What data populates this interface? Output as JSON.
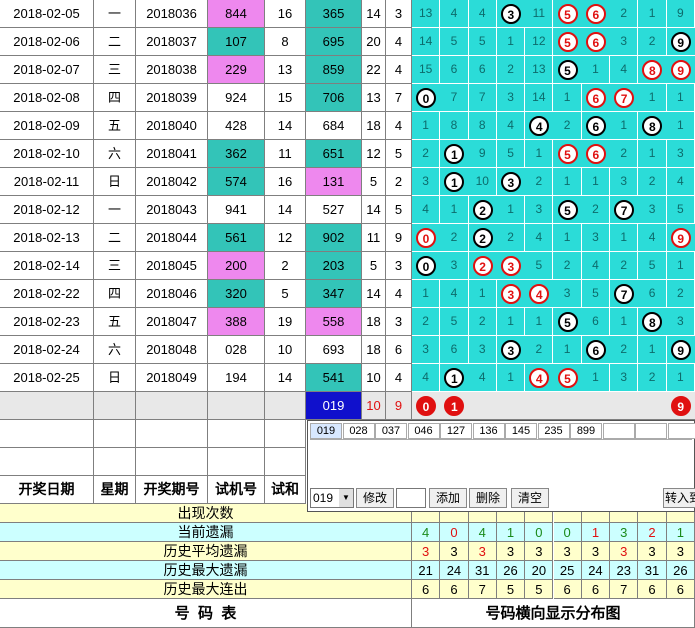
{
  "rows": [
    {
      "date": "2018-02-05",
      "weekday": "一",
      "issue": "2018036",
      "test": "844",
      "sum": "16",
      "draw": "365",
      "draw_sum": "14",
      "span": "3",
      "test_color": "pink",
      "draw_color": "teal",
      "cells": [
        "13",
        "4",
        "4",
        "3",
        "11",
        "5",
        "6",
        "2",
        "1",
        "9"
      ],
      "balls": [
        {
          "i": 3,
          "n": "3",
          "c": "black"
        },
        {
          "i": 5,
          "n": "5",
          "c": "red"
        },
        {
          "i": 6,
          "n": "6",
          "c": "red"
        }
      ]
    },
    {
      "date": "2018-02-06",
      "weekday": "二",
      "issue": "2018037",
      "test": "107",
      "sum": "8",
      "draw": "695",
      "draw_sum": "20",
      "span": "4",
      "test_color": "teal",
      "draw_color": "teal",
      "cells": [
        "14",
        "5",
        "5",
        "1",
        "12",
        "5",
        "6",
        "3",
        "2",
        "9"
      ],
      "balls": [
        {
          "i": 5,
          "n": "5",
          "c": "red"
        },
        {
          "i": 6,
          "n": "6",
          "c": "red"
        },
        {
          "i": 9,
          "n": "9",
          "c": "black"
        }
      ]
    },
    {
      "date": "2018-02-07",
      "weekday": "三",
      "issue": "2018038",
      "test": "229",
      "sum": "13",
      "draw": "859",
      "draw_sum": "22",
      "span": "4",
      "test_color": "pink",
      "draw_color": "teal",
      "cells": [
        "15",
        "6",
        "6",
        "2",
        "13",
        "5",
        "1",
        "4",
        "8",
        "9"
      ],
      "balls": [
        {
          "i": 5,
          "n": "5",
          "c": "black"
        },
        {
          "i": 8,
          "n": "8",
          "c": "red"
        },
        {
          "i": 9,
          "n": "9",
          "c": "red"
        }
      ]
    },
    {
      "date": "2018-02-08",
      "weekday": "四",
      "issue": "2018039",
      "test": "924",
      "sum": "15",
      "draw": "706",
      "draw_sum": "13",
      "span": "7",
      "test_color": "",
      "draw_color": "teal",
      "cells": [
        "0",
        "7",
        "7",
        "3",
        "14",
        "1",
        "6",
        "7",
        "1",
        "1"
      ],
      "balls": [
        {
          "i": 0,
          "n": "0",
          "c": "black"
        },
        {
          "i": 6,
          "n": "6",
          "c": "red"
        },
        {
          "i": 7,
          "n": "7",
          "c": "red"
        }
      ]
    },
    {
      "date": "2018-02-09",
      "weekday": "五",
      "issue": "2018040",
      "test": "428",
      "sum": "14",
      "draw": "684",
      "draw_sum": "18",
      "span": "4",
      "test_color": "",
      "draw_color": "",
      "cells": [
        "1",
        "8",
        "8",
        "4",
        "4",
        "2",
        "6",
        "1",
        "8",
        "1"
      ],
      "balls": [
        {
          "i": 4,
          "n": "4",
          "c": "black"
        },
        {
          "i": 6,
          "n": "6",
          "c": "black"
        },
        {
          "i": 8,
          "n": "8",
          "c": "black"
        }
      ]
    },
    {
      "date": "2018-02-10",
      "weekday": "六",
      "issue": "2018041",
      "test": "362",
      "sum": "11",
      "draw": "651",
      "draw_sum": "12",
      "span": "5",
      "test_color": "teal",
      "draw_color": "teal",
      "cells": [
        "2",
        "1",
        "9",
        "5",
        "1",
        "5",
        "6",
        "2",
        "1",
        "3"
      ],
      "balls": [
        {
          "i": 1,
          "n": "1",
          "c": "black"
        },
        {
          "i": 5,
          "n": "5",
          "c": "red"
        },
        {
          "i": 6,
          "n": "6",
          "c": "red"
        }
      ]
    },
    {
      "date": "2018-02-11",
      "weekday": "日",
      "issue": "2018042",
      "test": "574",
      "sum": "16",
      "draw": "131",
      "draw_sum": "5",
      "span": "2",
      "test_color": "teal",
      "draw_color": "pink",
      "cells": [
        "3",
        "1",
        "10",
        "3",
        "2",
        "1",
        "1",
        "3",
        "2",
        "4"
      ],
      "balls": [
        {
          "i": 1,
          "n": "1",
          "c": "black"
        },
        {
          "i": 3,
          "n": "3",
          "c": "black"
        }
      ]
    },
    {
      "date": "2018-02-12",
      "weekday": "一",
      "issue": "2018043",
      "test": "941",
      "sum": "14",
      "draw": "527",
      "draw_sum": "14",
      "span": "5",
      "test_color": "",
      "draw_color": "",
      "cells": [
        "4",
        "1",
        "2",
        "1",
        "3",
        "5",
        "2",
        "7",
        "3",
        "5"
      ],
      "balls": [
        {
          "i": 2,
          "n": "2",
          "c": "black"
        },
        {
          "i": 5,
          "n": "5",
          "c": "black"
        },
        {
          "i": 7,
          "n": "7",
          "c": "black"
        }
      ]
    },
    {
      "date": "2018-02-13",
      "weekday": "二",
      "issue": "2018044",
      "test": "561",
      "sum": "12",
      "draw": "902",
      "draw_sum": "11",
      "span": "9",
      "test_color": "teal",
      "draw_color": "teal",
      "cells": [
        "0",
        "2",
        "2",
        "2",
        "4",
        "1",
        "3",
        "1",
        "4",
        "9"
      ],
      "balls": [
        {
          "i": 0,
          "n": "0",
          "c": "red"
        },
        {
          "i": 2,
          "n": "2",
          "c": "black"
        },
        {
          "i": 9,
          "n": "9",
          "c": "red"
        }
      ]
    },
    {
      "date": "2018-02-14",
      "weekday": "三",
      "issue": "2018045",
      "test": "200",
      "sum": "2",
      "draw": "203",
      "draw_sum": "5",
      "span": "3",
      "test_color": "pink",
      "draw_color": "teal",
      "cells": [
        "0",
        "3",
        "2",
        "3",
        "5",
        "2",
        "4",
        "2",
        "5",
        "1"
      ],
      "balls": [
        {
          "i": 0,
          "n": "0",
          "c": "black"
        },
        {
          "i": 2,
          "n": "2",
          "c": "red"
        },
        {
          "i": 3,
          "n": "3",
          "c": "red"
        }
      ]
    },
    {
      "date": "2018-02-22",
      "weekday": "四",
      "issue": "2018046",
      "test": "320",
      "sum": "5",
      "draw": "347",
      "draw_sum": "14",
      "span": "4",
      "test_color": "teal",
      "draw_color": "teal",
      "cells": [
        "1",
        "4",
        "1",
        "3",
        "4",
        "3",
        "5",
        "7",
        "6",
        "2"
      ],
      "balls": [
        {
          "i": 3,
          "n": "3",
          "c": "red"
        },
        {
          "i": 4,
          "n": "4",
          "c": "red"
        },
        {
          "i": 7,
          "n": "7",
          "c": "black"
        }
      ]
    },
    {
      "date": "2018-02-23",
      "weekday": "五",
      "issue": "2018047",
      "test": "388",
      "sum": "19",
      "draw": "558",
      "draw_sum": "18",
      "span": "3",
      "test_color": "pink",
      "draw_color": "pink",
      "cells": [
        "2",
        "5",
        "2",
        "1",
        "1",
        "5",
        "6",
        "1",
        "8",
        "3"
      ],
      "balls": [
        {
          "i": 5,
          "n": "5",
          "c": "black"
        },
        {
          "i": 8,
          "n": "8",
          "c": "black"
        }
      ]
    },
    {
      "date": "2018-02-24",
      "weekday": "六",
      "issue": "2018048",
      "test": "028",
      "sum": "10",
      "draw": "693",
      "draw_sum": "18",
      "span": "6",
      "test_color": "",
      "draw_color": "",
      "cells": [
        "3",
        "6",
        "3",
        "3",
        "2",
        "1",
        "6",
        "2",
        "1",
        "9"
      ],
      "balls": [
        {
          "i": 3,
          "n": "3",
          "c": "black"
        },
        {
          "i": 6,
          "n": "6",
          "c": "black"
        },
        {
          "i": 9,
          "n": "9",
          "c": "black"
        }
      ]
    },
    {
      "date": "2018-02-25",
      "weekday": "日",
      "issue": "2018049",
      "test": "194",
      "sum": "14",
      "draw": "541",
      "draw_sum": "10",
      "span": "4",
      "test_color": "",
      "draw_color": "teal",
      "cells": [
        "4",
        "1",
        "4",
        "1",
        "4",
        "5",
        "1",
        "3",
        "2",
        "1"
      ],
      "balls": [
        {
          "i": 1,
          "n": "1",
          "c": "black"
        },
        {
          "i": 4,
          "n": "4",
          "c": "red"
        },
        {
          "i": 5,
          "n": "5",
          "c": "red"
        }
      ]
    }
  ],
  "current": {
    "draw": "019",
    "draw_sum": "10",
    "span": "9",
    "balls": [
      {
        "i": 0,
        "n": "0"
      },
      {
        "i": 1,
        "n": "1"
      },
      {
        "i": 9,
        "n": "9"
      }
    ]
  },
  "headers": {
    "date": "开奖日期",
    "weekday": "星期",
    "issue": "开奖期号",
    "test": "试机号",
    "sum": "试和"
  },
  "panel": {
    "tabs": [
      "019",
      "028",
      "037",
      "046",
      "127",
      "136",
      "145",
      "235",
      "899",
      "",
      "",
      ""
    ],
    "select_value": "019",
    "input_value": "",
    "buttons": {
      "edit": "修改",
      "add": "添加",
      "delete": "删除",
      "clear": "清空",
      "transfer": "转入到"
    }
  },
  "stats": {
    "labels": [
      "出现次数",
      "当前遗漏",
      "历史平均遗漏",
      "历史最大遗漏",
      "历史最大连出"
    ],
    "appear": [
      "",
      "",
      "",
      "",
      "",
      "",
      "",
      "",
      "",
      ""
    ],
    "current_miss": [
      "4",
      "0",
      "4",
      "1",
      "0",
      "0",
      "1",
      "3",
      "2",
      "1"
    ],
    "avg_miss": [
      "3",
      "3",
      "3",
      "3",
      "3",
      "3",
      "3",
      "3",
      "3",
      "3"
    ],
    "max_miss": [
      "21",
      "24",
      "31",
      "26",
      "20",
      "25",
      "24",
      "23",
      "31",
      "26"
    ],
    "max_streak": [
      "6",
      "6",
      "7",
      "5",
      "5",
      "6",
      "6",
      "7",
      "6",
      "6"
    ]
  },
  "footer": {
    "left": "号  码  表",
    "right": "号码横向显示分布图"
  },
  "colors": {
    "pink": "#ee88ee",
    "teal": "#33c4b8",
    "cyan": "#2bdcd8",
    "red": "#e01010",
    "yellow": "#ffffcc",
    "lightcyan": "#ccffff"
  }
}
